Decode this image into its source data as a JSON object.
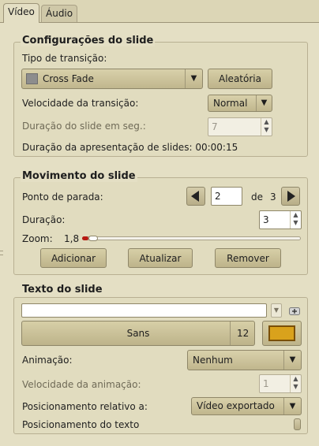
{
  "tabs": [
    {
      "label": "Vídeo",
      "active": true
    },
    {
      "label": "Áudio",
      "active": false
    }
  ],
  "slide_settings": {
    "title": "Configurações do slide",
    "transition_type_label": "Tipo de transição:",
    "transition_value": "Cross Fade",
    "random_button": "Aleatória",
    "transition_speed_label": "Velocidade da transição:",
    "transition_speed_value": "Normal",
    "slide_duration_label": "Duração do slide em seg.:",
    "slide_duration_value": "7",
    "presentation_duration_label": "Duração da apresentação de slides:",
    "presentation_duration_value": "00:00:15"
  },
  "slide_motion": {
    "title": "Movimento do slide",
    "stop_point_label": "Ponto de parada:",
    "stop_point_value": "2",
    "of_label": "de",
    "total_points": "3",
    "duration_label": "Duração:",
    "duration_value": "3",
    "zoom_label": "Zoom:",
    "zoom_value": "1,8",
    "zoom_fraction": 0.03,
    "add_button": "Adicionar",
    "update_button": "Atualizar",
    "remove_button": "Remover"
  },
  "slide_text": {
    "title": "Texto do slide",
    "text_value": "",
    "font_name": "Sans",
    "font_size": "12",
    "color_swatch": "#d9a21c",
    "animation_label": "Animação:",
    "animation_value": "Nenhum",
    "animation_speed_label": "Velocidade da animação:",
    "animation_speed_value": "1",
    "relative_position_label": "Posicionamento relativo a:",
    "relative_position_value": "Vídeo exportado",
    "text_position_label": "Posicionamento do texto"
  },
  "colors": {
    "window_bg": "#dcd6b6",
    "panel_bg": "#e4dfc4",
    "accent_red": "#b71a12"
  }
}
